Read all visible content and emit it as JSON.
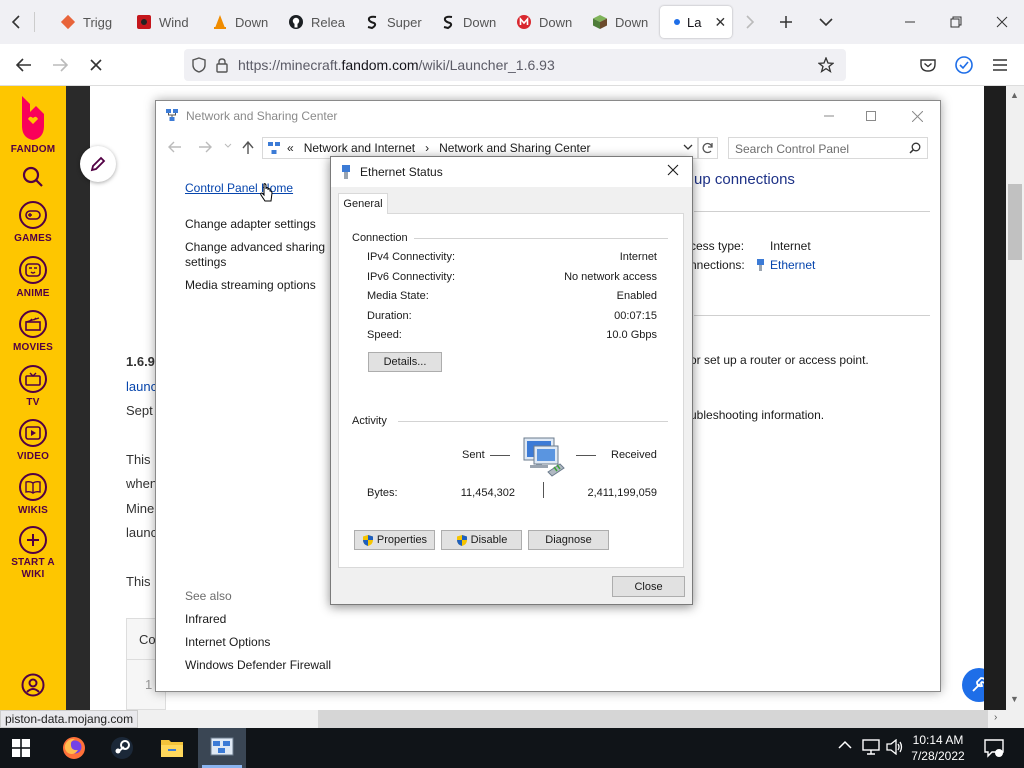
{
  "browser": {
    "tabs": [
      {
        "label": "Trigg",
        "icon": "diamond-icon",
        "color": "#e8643a"
      },
      {
        "label": "Wind",
        "icon": "red-square-icon",
        "color": "#c4161c"
      },
      {
        "label": "Down",
        "icon": "vlc-cone-icon",
        "color": "#f08c00"
      },
      {
        "label": "Relea",
        "icon": "github-icon",
        "color": "#1b1f23"
      },
      {
        "label": "Super",
        "icon": "brand-s-icon",
        "color": "#1b1b1b"
      },
      {
        "label": "Down",
        "icon": "brand-s-icon",
        "color": "#1b1b1b"
      },
      {
        "label": "Down",
        "icon": "mega-icon",
        "color": "#d9272e"
      },
      {
        "label": "Down",
        "icon": "cube-icon",
        "color": "#4f7d3a"
      },
      {
        "label": "La",
        "icon": "dot-icon",
        "color": "#1e6ee8"
      }
    ],
    "url_prefix": "https://minecraft.",
    "url_domain": "fandom.com",
    "url_path": "/wiki/Launcher_1.6.93",
    "status_url": "piston-data.mojang.com"
  },
  "fandom": {
    "logo_label": "FANDOM",
    "items": [
      {
        "label": "GAMES",
        "icon": "controller-icon"
      },
      {
        "label": "ANIME",
        "icon": "anime-face-icon"
      },
      {
        "label": "MOVIES",
        "icon": "clapper-icon"
      },
      {
        "label": "TV",
        "icon": "tv-icon"
      },
      {
        "label": "VIDEO",
        "icon": "play-icon"
      },
      {
        "label": "WIKIS",
        "icon": "book-icon"
      },
      {
        "label": "START A WIKI",
        "icon": "plus-icon"
      }
    ],
    "accent": "#fec600",
    "text_color": "#520044"
  },
  "page": {
    "heading": "1.6.9",
    "link": "launc",
    "date": "Sept",
    "lines": [
      "This",
      "when",
      "Mine",
      "launc",
      "This"
    ],
    "table_head": "Co",
    "table_cell": "1"
  },
  "nsc": {
    "title": "Network and Sharing Center",
    "crumb1": "Network and Internet",
    "crumb2": "Network and Sharing Center",
    "crumb_sep": "«",
    "crumb_arrow": "›",
    "search_placeholder": "Search Control Panel",
    "home_link": "Control Panel Home",
    "left_links": [
      "Change adapter settings",
      "Change advanced sharing settings",
      "Media streaming options"
    ],
    "see_also": "See also",
    "see_also_links": [
      "Infrared",
      "Internet Options",
      "Windows Defender Firewall"
    ],
    "right_heading": "up connections",
    "access_type_label": "cess type:",
    "access_type_value": "Internet",
    "connections_label": "nnections:",
    "connections_value": "Ethernet",
    "right_text1": "or set up a router or access point.",
    "right_text2": "ubleshooting information."
  },
  "ethernet": {
    "title": "Ethernet Status",
    "tab": "General",
    "connection_group": "Connection",
    "rows": [
      {
        "label": "IPv4 Connectivity:",
        "value": "Internet"
      },
      {
        "label": "IPv6 Connectivity:",
        "value": "No network access"
      },
      {
        "label": "Media State:",
        "value": "Enabled"
      },
      {
        "label": "Duration:",
        "value": "00:07:15"
      },
      {
        "label": "Speed:",
        "value": "10.0 Gbps"
      }
    ],
    "details_button": "Details...",
    "activity_group": "Activity",
    "sent_label": "Sent",
    "received_label": "Received",
    "bytes_label": "Bytes:",
    "bytes_sent": "11,454,302",
    "bytes_received": "2,411,199,059",
    "properties_button": "Properties",
    "disable_button": "Disable",
    "diagnose_button": "Diagnose",
    "close_button": "Close"
  },
  "taskbar": {
    "time": "10:14 AM",
    "date": "7/28/2022"
  }
}
